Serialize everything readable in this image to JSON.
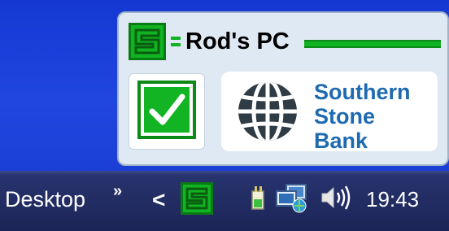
{
  "popup": {
    "computer_name": "Rod's PC",
    "bank_name_lines": [
      "Southern",
      "Stone",
      "Bank"
    ]
  },
  "taskbar": {
    "toolbar_label": "Desktop",
    "more_chevron": "»",
    "tray_expand": "<",
    "clock": "19:43"
  },
  "colors": {
    "brand_green": "#10b321",
    "bank_blue": "#1d6ab0",
    "desktop_blue": "#1b3fd6",
    "taskbar": "#1c2557"
  },
  "icons": [
    "app-logo-icon",
    "checkmark-icon",
    "globe-icon",
    "power-icon",
    "network-icon",
    "volume-icon"
  ]
}
